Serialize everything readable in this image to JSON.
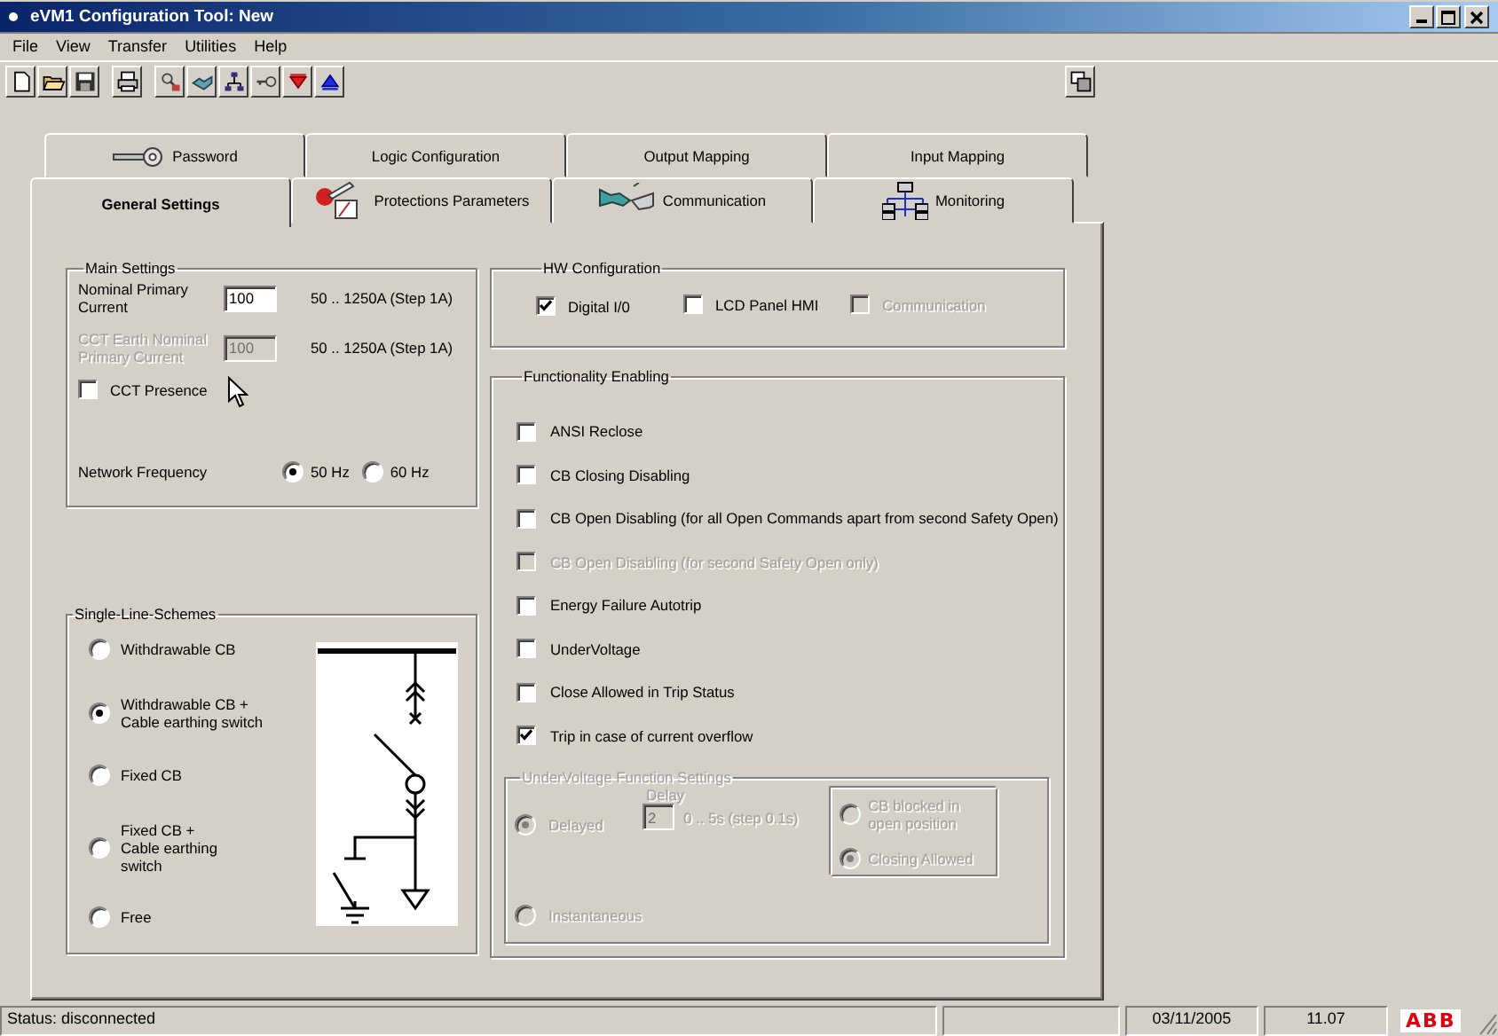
{
  "window": {
    "title": "eVM1 Configuration Tool:  New"
  },
  "menu": [
    "File",
    "View",
    "Transfer",
    "Utilities",
    "Help"
  ],
  "tab_rows": [
    {
      "tabs": [
        {
          "label": "Password",
          "selected": false
        },
        {
          "label": "Logic Configuration",
          "selected": false
        },
        {
          "label": "Output Mapping",
          "selected": false
        },
        {
          "label": "Input Mapping",
          "selected": false
        }
      ]
    },
    {
      "tabs": [
        {
          "label": "General Settings",
          "selected": true
        },
        {
          "label": "Protections Parameters",
          "selected": false
        },
        {
          "label": "Communication",
          "selected": false
        },
        {
          "label": "Monitoring",
          "selected": false
        }
      ]
    }
  ],
  "main_settings": {
    "title": "Main Settings",
    "fields": [
      {
        "label": "Nominal Primary Current",
        "value": "100",
        "range": "50 .. 1250A (Step 1A)",
        "disabled": false
      },
      {
        "label": "CCT Earth Nominal Primary Current",
        "value": "100",
        "range": "50 .. 1250A (Step 1A)",
        "disabled": true
      }
    ],
    "cct_presence": {
      "label": "CCT Presence",
      "checked": false,
      "disabled": false
    },
    "network_frequency": {
      "label": "Network Frequency",
      "options": [
        {
          "label": "50 Hz",
          "selected": true
        },
        {
          "label": "60 Hz",
          "selected": false
        }
      ]
    }
  },
  "single_line_schemes": {
    "title": "Single-Line-Schemes",
    "options": [
      {
        "label": "Withdrawable CB",
        "selected": false
      },
      {
        "label": "Withdrawable CB + Cable earthing switch",
        "selected": true
      },
      {
        "label": "Fixed CB",
        "selected": false
      },
      {
        "label": "Fixed CB + Cable earthing switch",
        "selected": false
      },
      {
        "label": "Free",
        "selected": false
      }
    ]
  },
  "hw_configuration": {
    "title": "HW Configuration",
    "options": [
      {
        "label": "Digital I/0",
        "checked": true,
        "disabled": false
      },
      {
        "label": "LCD Panel HMI",
        "checked": false,
        "disabled": false
      },
      {
        "label": "Communication",
        "checked": false,
        "disabled": true
      }
    ]
  },
  "functionality_enabling": {
    "title": "Functionality Enabling",
    "options": [
      {
        "label": "ANSI Reclose",
        "checked": false,
        "disabled": false
      },
      {
        "label": "CB Closing Disabling",
        "checked": false,
        "disabled": false
      },
      {
        "label": "CB Open Disabling (for all Open Commands apart from second Safety Open)",
        "checked": false,
        "disabled": false
      },
      {
        "label": "CB Open Disabling (for second Safety Open only)",
        "checked": false,
        "disabled": true
      },
      {
        "label": "Energy Failure Autotrip",
        "checked": false,
        "disabled": false
      },
      {
        "label": "UnderVoltage",
        "checked": false,
        "disabled": false
      },
      {
        "label": "Close Allowed in Trip Status",
        "checked": false,
        "disabled": false
      },
      {
        "label": "Trip in case of current overflow",
        "checked": true,
        "disabled": false
      }
    ],
    "undervoltage_settings": {
      "title": "UnderVoltage Function Settings",
      "disabled": true,
      "modes": [
        {
          "label": "Delayed",
          "selected": true
        },
        {
          "label": "Instantaneous",
          "selected": false
        }
      ],
      "delay": {
        "label": "Delay",
        "value": "2",
        "range": "0 .. 5s (step 0.1s)"
      },
      "blocking": [
        {
          "label": "CB blocked in open position",
          "selected": false
        },
        {
          "label": "Closing Allowed",
          "selected": true
        }
      ]
    }
  },
  "status_bar": {
    "status": "Status: disconnected",
    "date": "03/11/2005",
    "time": "11.07",
    "logo": "ABB"
  }
}
